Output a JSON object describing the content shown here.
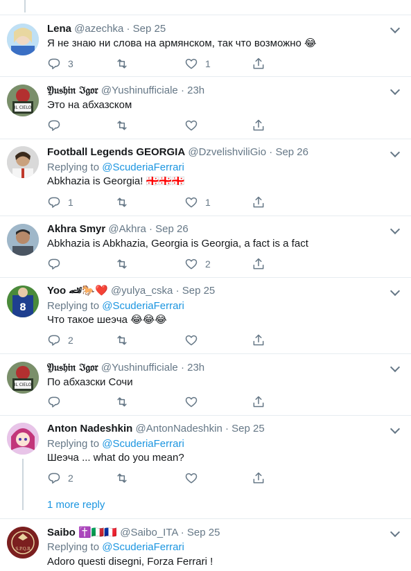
{
  "tweets": [
    {
      "name": "Lena",
      "handle": "@azechka",
      "time": "Sep 25",
      "replying_label": "",
      "replying_to": "",
      "text": "Я не знаю ни слова на армянском, так что возможно 😂",
      "replies": "3",
      "retweets": "",
      "likes": "1"
    },
    {
      "name": "𝔜𝔲𝔰𝔥𝔦𝔫 ℑ𝔤𝔬𝔯",
      "handle": "@Yushinufficiale",
      "time": "23h",
      "replying_label": "",
      "replying_to": "",
      "text": "Это на абхазском",
      "replies": "",
      "retweets": "",
      "likes": ""
    },
    {
      "name": "Football Legends GEORGIA",
      "handle": "@DzvelishviliGio",
      "time": "Sep 26",
      "replying_label": "Replying to",
      "replying_to": "@ScuderiaFerrari",
      "text": "Abkhazia is Georgia! 🇬🇪🇬🇪🇬🇪",
      "replies": "1",
      "retweets": "",
      "likes": "1"
    },
    {
      "name": "Akhra Smyr",
      "handle": "@Akhra",
      "time": "Sep 26",
      "replying_label": "",
      "replying_to": "",
      "text": "Abkhazia is Abkhazia, Georgia is Georgia, a fact is a fact",
      "replies": "",
      "retweets": "",
      "likes": "2"
    },
    {
      "name": "Yoo 🏎🐎❤️",
      "handle": "@yulya_cska",
      "time": "Sep 25",
      "replying_label": "Replying to",
      "replying_to": "@ScuderiaFerrari",
      "text": "Что такое шеэча 😂😂😂",
      "replies": "2",
      "retweets": "",
      "likes": ""
    },
    {
      "name": "𝔜𝔲𝔰𝔥𝔦𝔫 ℑ𝔤𝔬𝔯",
      "handle": "@Yushinufficiale",
      "time": "23h",
      "replying_label": "",
      "replying_to": "",
      "text": "По абхазски Сочи",
      "replies": "",
      "retweets": "",
      "likes": ""
    },
    {
      "name": "Anton Nadeshkin",
      "handle": "@AntonNadeshkin",
      "time": "Sep 25",
      "replying_label": "Replying to",
      "replying_to": "@ScuderiaFerrari",
      "text": "Шеэча ... what do you mean?",
      "replies": "2",
      "retweets": "",
      "likes": ""
    },
    {
      "name": "Saibo ✝️🇮🇹🇫🇷",
      "handle": "@Saibo_ITA",
      "time": "Sep 25",
      "replying_label": "Replying to",
      "replying_to": "@ScuderiaFerrari",
      "text": "Adoro questi disegni, Forza Ferrari !",
      "replies": "",
      "retweets": "",
      "likes": ""
    }
  ],
  "more_reply": "1 more reply",
  "dot": "·",
  "icons": {
    "reply": "reply-icon",
    "retweet": "retweet-icon",
    "like": "heart-icon",
    "share": "share-icon",
    "caret": "chevron-down-icon"
  },
  "colors": {
    "link": "#1b95e0",
    "secondary": "#657786",
    "divider": "#e6ecf0"
  }
}
